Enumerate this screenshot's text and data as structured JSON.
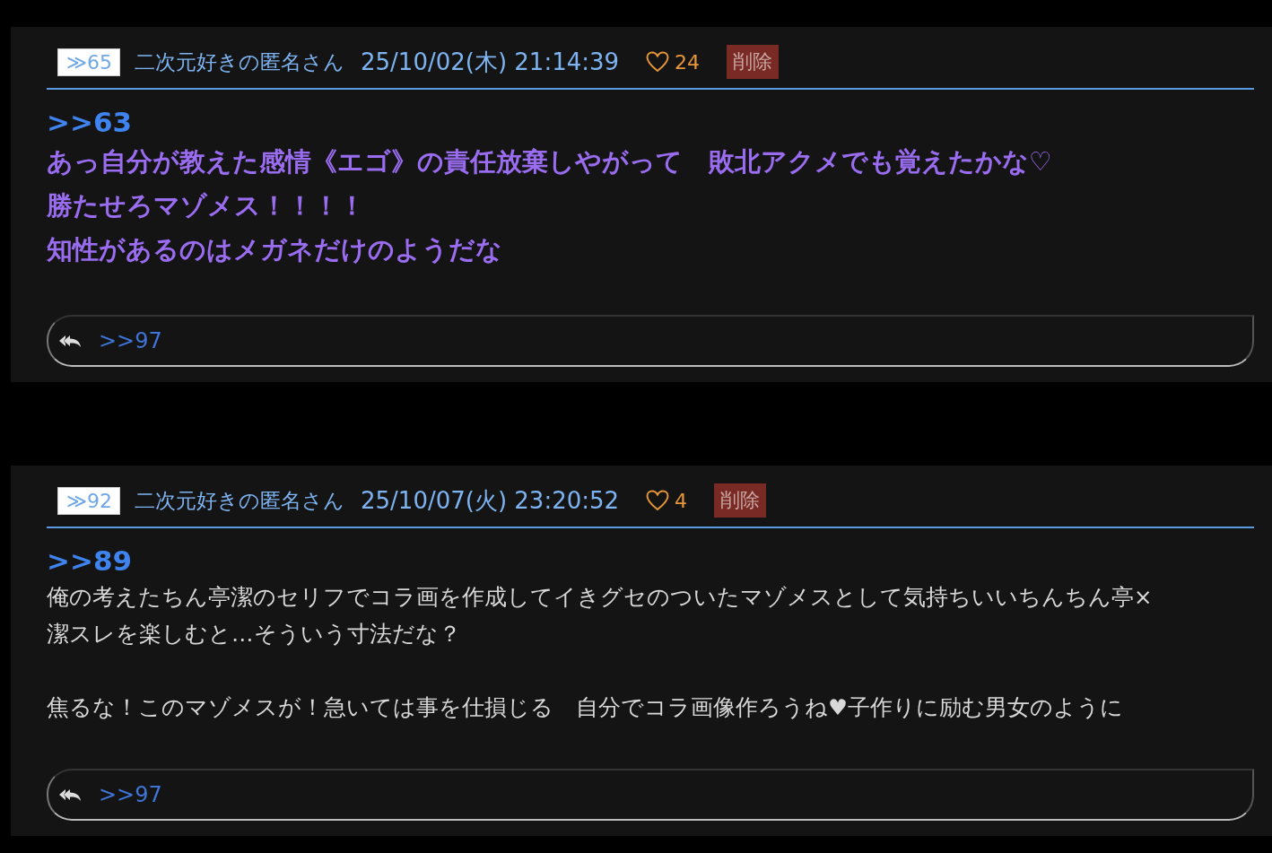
{
  "posts": [
    {
      "number": "≫65",
      "author": "二次元好きの匿名さん",
      "date": "25/10/02(木) 21:14:39",
      "likes": "24",
      "delete_label": "削除",
      "anchor": ">>63",
      "kind": "emphasis",
      "color": "#9a6cf0",
      "paragraphs": [
        [
          "あっ自分が教えた感情《エゴ》の責任放棄しやがって　敗北アクメでも覚えたかな♡",
          "勝たせろマゾメス！！！！",
          "知性があるのはメガネだけのようだな"
        ]
      ],
      "reply_links": [
        ">>97"
      ]
    },
    {
      "number": "≫92",
      "author": "二次元好きの匿名さん",
      "date": "25/10/07(火) 23:20:52",
      "likes": "4",
      "delete_label": "削除",
      "anchor": ">>89",
      "kind": "plain",
      "color": "#d8d8d8",
      "paragraphs": [
        [
          "俺の考えたちん亭潔のセリフでコラ画を作成してイきグセのついたマゾメスとして気持ちいいちんちん亭×",
          "潔スレを楽しむと…そういう寸法だな？"
        ],
        [
          "焦るな！このマゾメスが！急いては事を仕損じる　自分でコラ画像作ろうね♥子作りに励む男女のように"
        ]
      ],
      "reply_links": [
        ">>97"
      ]
    }
  ]
}
